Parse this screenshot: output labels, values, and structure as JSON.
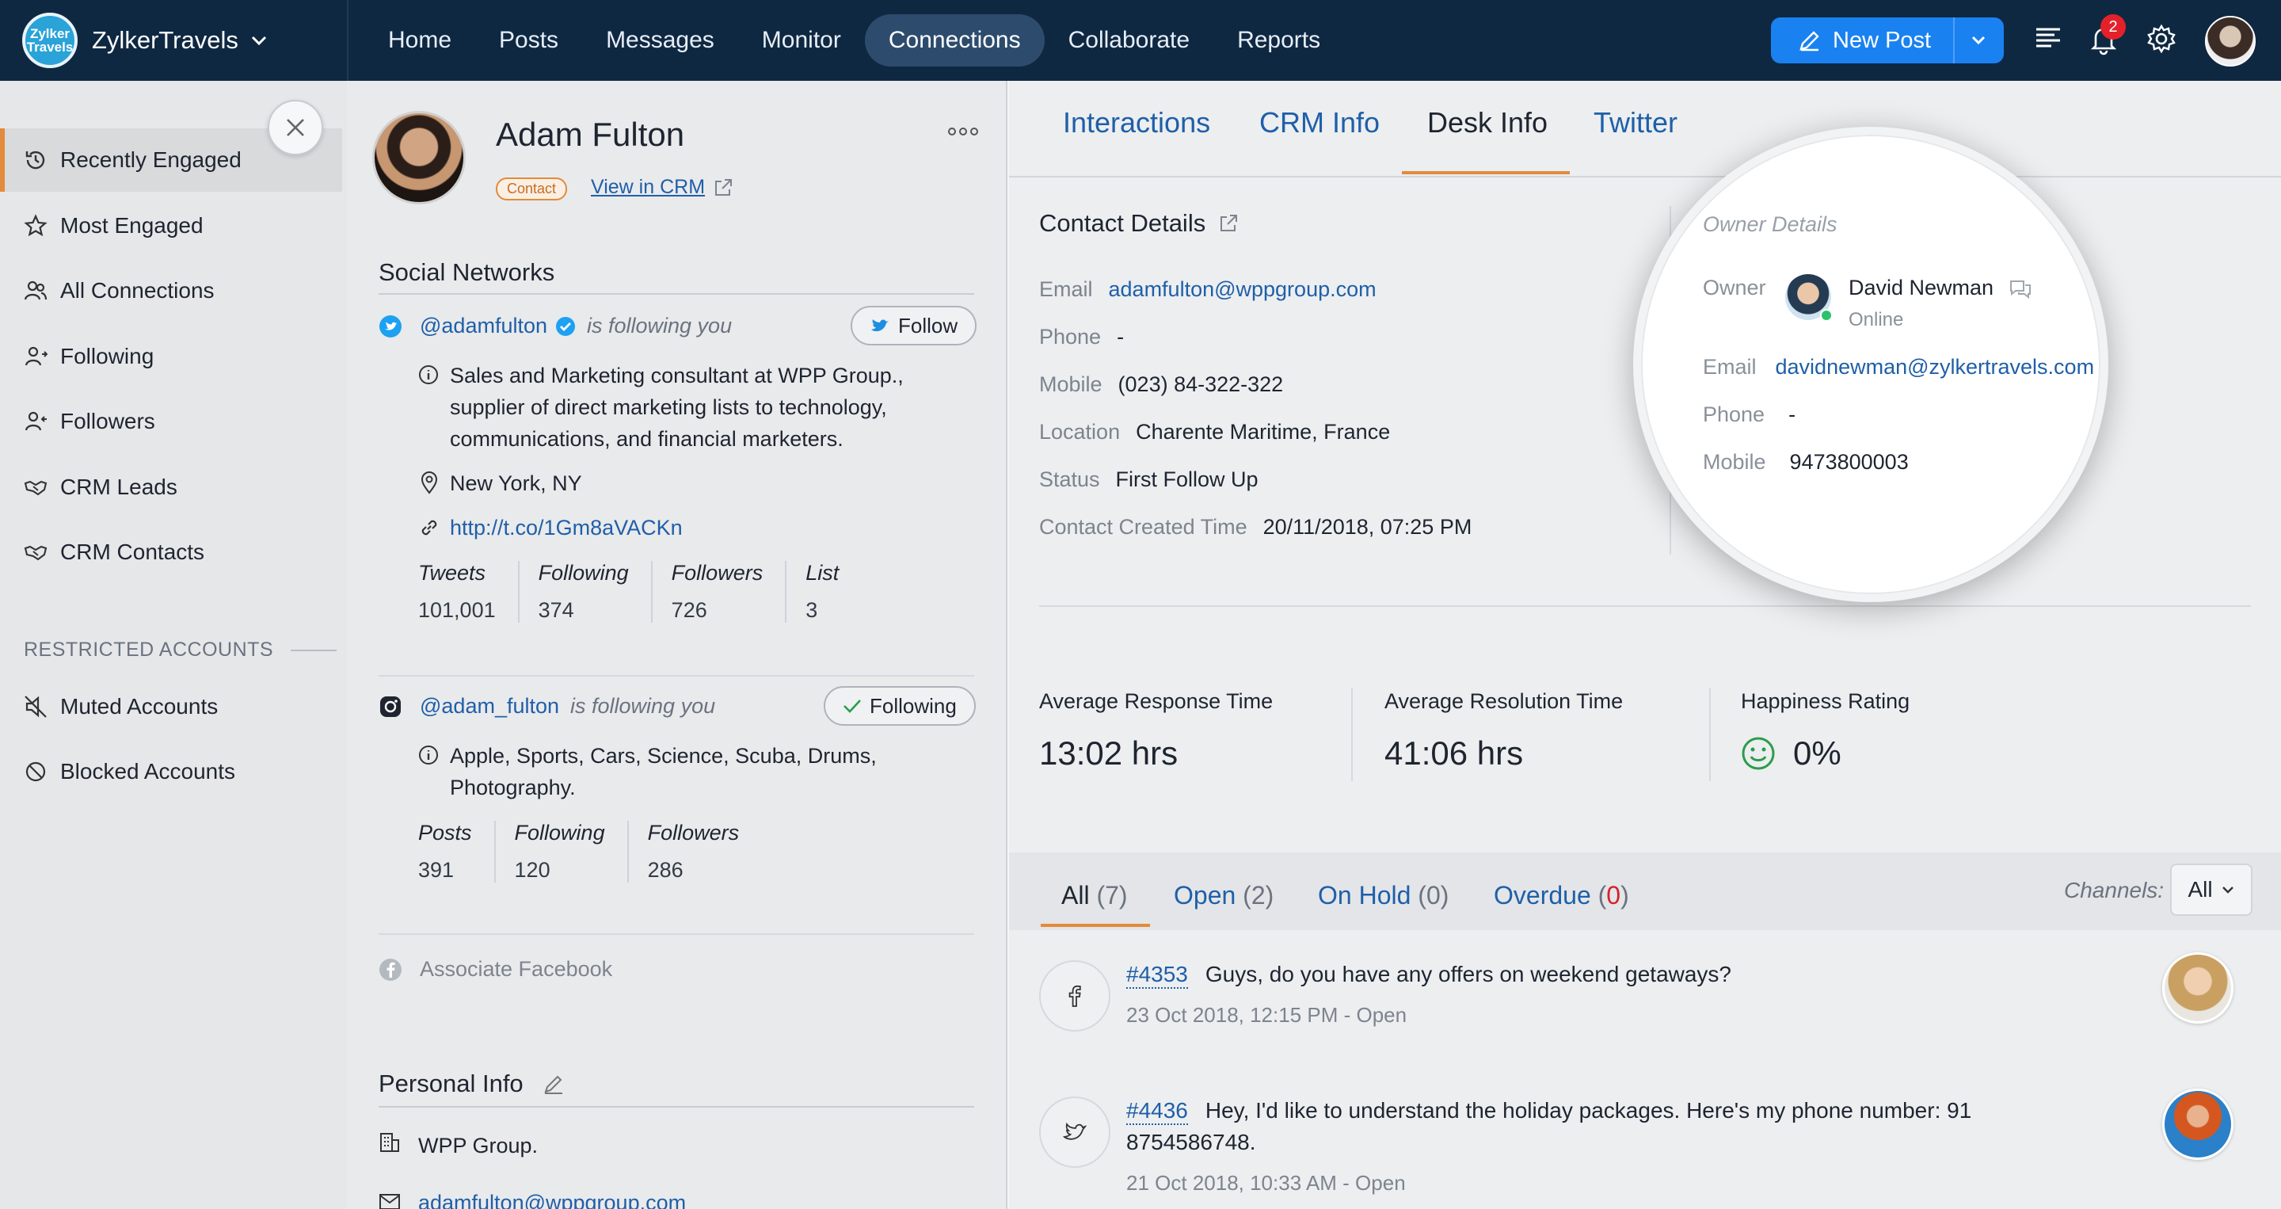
{
  "brand": {
    "name": "ZylkerTravels",
    "logo_text": "Zylker Travels"
  },
  "nav": [
    "Home",
    "Posts",
    "Messages",
    "Monitor",
    "Connections",
    "Collaborate",
    "Reports"
  ],
  "toolbar": {
    "new_post": "New Post",
    "notif_count": "2"
  },
  "sidebar": {
    "items": [
      {
        "label": "Recently Engaged",
        "icon": "clock-icon"
      },
      {
        "label": "Most Engaged",
        "icon": "star-icon"
      },
      {
        "label": "All Connections",
        "icon": "users-icon"
      },
      {
        "label": "Following",
        "icon": "user-follow-icon"
      },
      {
        "label": "Followers",
        "icon": "user-followers-icon"
      },
      {
        "label": "CRM Leads",
        "icon": "handshake-icon"
      },
      {
        "label": "CRM Contacts",
        "icon": "handshake-icon"
      }
    ],
    "restricted_header": "RESTRICTED ACCOUNTS",
    "restricted": [
      {
        "label": "Muted Accounts",
        "icon": "mute-icon"
      },
      {
        "label": "Blocked Accounts",
        "icon": "block-icon"
      }
    ]
  },
  "profile": {
    "name": "Adam Fulton",
    "tag": "Contact",
    "view_crm": "View in CRM",
    "social_title": "Social Networks",
    "twitter": {
      "handle": "@adamfulton",
      "following_text": "is following you",
      "button": "Follow",
      "bio_lines": [
        "Sales and Marketing consultant at WPP Group.,",
        "supplier of direct marketing lists to technology,",
        "communications, and financial marketers."
      ],
      "location": "New York, NY",
      "url": "http://t.co/1Gm8aVACKn",
      "stats": [
        {
          "h": "Tweets",
          "v": "101,001"
        },
        {
          "h": "Following",
          "v": "374"
        },
        {
          "h": "Followers",
          "v": "726"
        },
        {
          "h": "List",
          "v": "3"
        }
      ]
    },
    "instagram": {
      "handle": "@adam_fulton",
      "following_text": "is following you",
      "button": "Following",
      "bio_lines": [
        "Apple, Sports, Cars, Science, Scuba, Drums,",
        "Photography."
      ],
      "stats": [
        {
          "h": "Posts",
          "v": "391"
        },
        {
          "h": "Following",
          "v": "120"
        },
        {
          "h": "Followers",
          "v": "286"
        }
      ]
    },
    "facebook": {
      "label": "Associate Facebook"
    },
    "personal_title": "Personal Info",
    "company": "WPP Group.",
    "email": "adamfulton@wppgroup.com"
  },
  "right": {
    "tabs": [
      "Interactions",
      "CRM Info",
      "Desk Info",
      "Twitter"
    ],
    "contact_title": "Contact Details",
    "contact": [
      {
        "k": "Email",
        "v": "adamfulton@wppgroup.com"
      },
      {
        "k": "Phone",
        "v": "-"
      },
      {
        "k": "Mobile",
        "v": "(023) 84-322-322"
      },
      {
        "k": "Location",
        "v": "Charente Maritime, France"
      },
      {
        "k": "Status",
        "v": "First Follow Up"
      },
      {
        "k": "Contact Created Time",
        "v": "20/11/2018, 07:25 PM"
      }
    ],
    "owner": {
      "title": "Owner Details",
      "owner_label": "Owner",
      "name": "David Newman",
      "status": "Online",
      "email_label": "Email",
      "email": "davidnewman@zylkertravels.com",
      "phone_label": "Phone",
      "phone": "-",
      "mobile_label": "Mobile",
      "mobile": "9473800003"
    },
    "metrics": [
      {
        "k": "Average Response Time",
        "v": "13:02 hrs"
      },
      {
        "k": "Average Resolution Time",
        "v": "41:06 hrs"
      },
      {
        "k": "Happiness Rating",
        "v": "0%"
      }
    ],
    "ticket_tabs": [
      {
        "label": "All",
        "count": "(7)"
      },
      {
        "label": "Open",
        "count": "(2)"
      },
      {
        "label": "On Hold",
        "count": "(0)"
      },
      {
        "label": "Overdue",
        "count": "0"
      }
    ],
    "channels_label": "Channels:",
    "channels_value": "All",
    "tickets": [
      {
        "id": "#4353",
        "subject": "Guys, do you have any offers on weekend getaways?",
        "subject2": "",
        "meta": "23 Oct 2018, 12:15 PM   -   Open",
        "channel": "facebook-icon"
      },
      {
        "id": "#4436",
        "subject": "Hey, I'd like to understand the holiday packages. Here's my phone number: 91",
        "subject2": "8754586748.",
        "meta": "21 Oct 2018, 10:33 AM   -   Open",
        "channel": "twitter-icon"
      }
    ]
  },
  "colors": {
    "topbar": "#0f2842",
    "accent": "#1a82f0",
    "orange": "#e38b3b",
    "link": "#1f5fa8"
  }
}
